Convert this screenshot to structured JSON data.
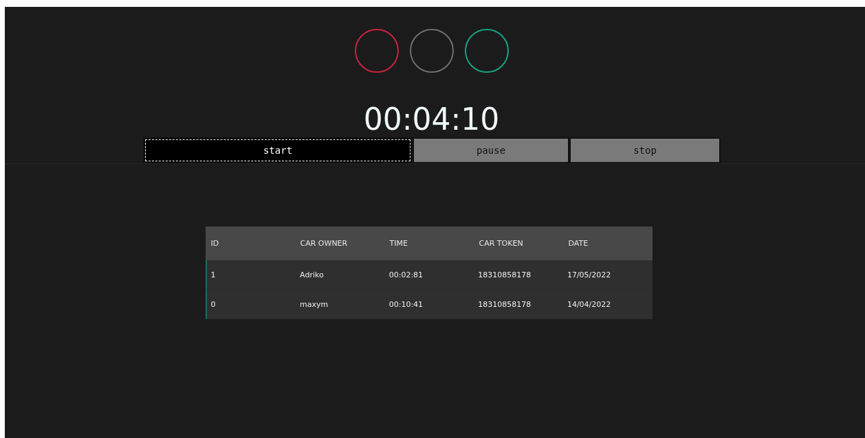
{
  "lights": [
    {
      "color": "#c8233f"
    },
    {
      "color": "#6e6e6e"
    },
    {
      "color": "#17a383"
    }
  ],
  "timer": "00:04:10",
  "buttons": [
    {
      "label": "start",
      "focused": true
    },
    {
      "label": "pause",
      "focused": false
    },
    {
      "label": "stop",
      "focused": false
    }
  ],
  "table": {
    "columns": [
      "ID",
      "CAR OWNER",
      "TIME",
      "CAR TOKEN",
      "DATE"
    ],
    "rows": [
      [
        "1",
        "Adriko",
        "00:02:81",
        "18310858178",
        "17/05/2022"
      ],
      [
        "0",
        "maxym",
        "00:10:41",
        "18310858178",
        "14/04/2022"
      ]
    ]
  }
}
